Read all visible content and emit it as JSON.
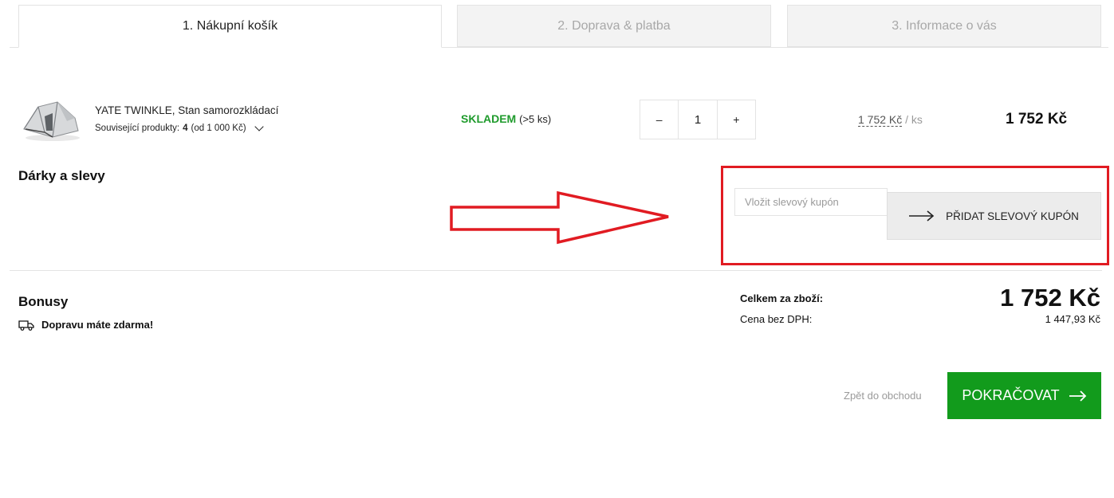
{
  "tabs": [
    {
      "label": "1. Nákupní košík",
      "active": true
    },
    {
      "label": "2. Doprava & platba",
      "active": false
    },
    {
      "label": "3. Informace o vás",
      "active": false
    }
  ],
  "cart_item": {
    "name": "YATE TWINKLE, Stan samorozkládací",
    "related_label": "Související produkty:",
    "related_count": "4",
    "related_from": "(od 1 000 Kč)",
    "stock_status": "SKLADEM",
    "stock_qty": "(>5 ks)",
    "qty_minus": "–",
    "quantity": "1",
    "qty_plus": "+",
    "unit_price": "1 752 Kč",
    "unit_suffix": " / ks",
    "total": "1 752 Kč"
  },
  "gifts": {
    "heading": "Dárky a slevy",
    "coupon_placeholder": "Vložit slevový kupón",
    "coupon_button": "PŘIDAT SLEVOVÝ KUPÓN"
  },
  "bonuses": {
    "heading": "Bonusy",
    "shipping_note": "Dopravu máte zdarma!"
  },
  "totals": {
    "goods_label": "Celkem za zboží:",
    "goods_value": "1 752 Kč",
    "net_label": "Cena bez DPH:",
    "net_value": "1 447,93 Kč"
  },
  "actions": {
    "back_link": "Zpět do obchodu",
    "continue_button": "POKRAČOVAT"
  },
  "colors": {
    "accent_green": "#129b1c",
    "stock_green": "#1f9b2c",
    "annotation_red": "#e11b22"
  }
}
